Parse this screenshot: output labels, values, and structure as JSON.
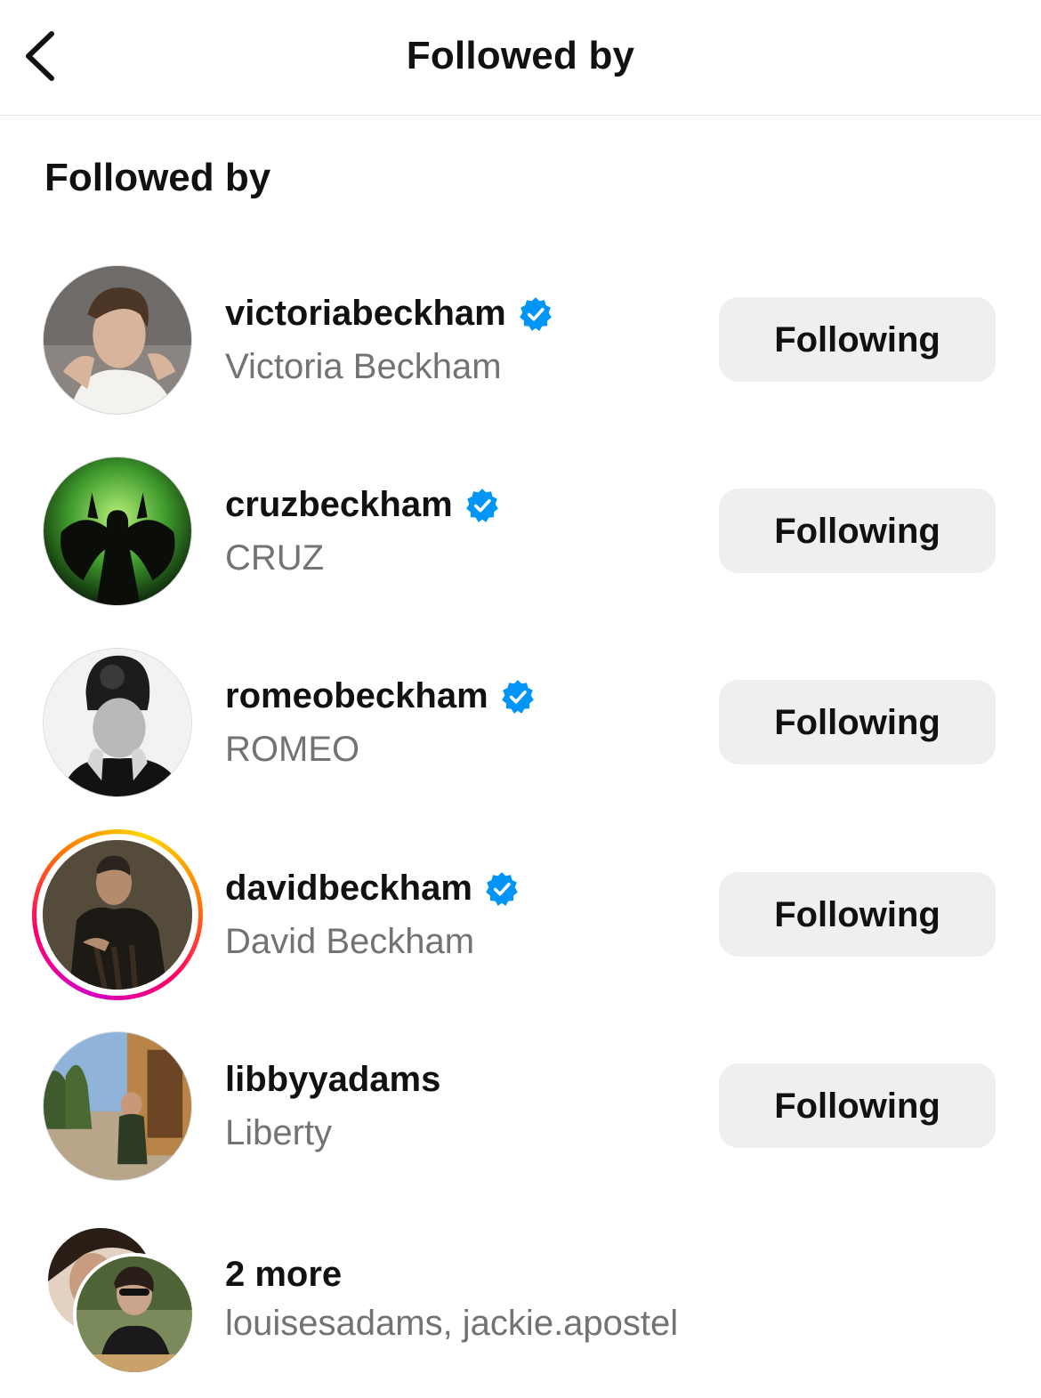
{
  "header": {
    "title": "Followed by",
    "back_icon": "chevron-left-icon"
  },
  "section": {
    "title": "Followed by"
  },
  "accounts": [
    {
      "username": "victoriabeckham",
      "full_name": "Victoria Beckham",
      "verified": true,
      "button": "Following"
    },
    {
      "username": "cruzbeckham",
      "full_name": "CRUZ",
      "verified": true,
      "button": "Following"
    },
    {
      "username": "romeobeckham",
      "full_name": "ROMEO",
      "verified": true,
      "button": "Following"
    },
    {
      "username": "davidbeckham",
      "full_name": "David Beckham",
      "verified": true,
      "has_story": true,
      "button": "Following"
    },
    {
      "username": "libbyyadams",
      "full_name": "Liberty",
      "verified": false,
      "button": "Following"
    }
  ],
  "more": {
    "title": "2 more",
    "names": "louisesadams, jackie.apostel"
  },
  "colors": {
    "verified_blue": "#0095f6",
    "button_bg": "#efefef",
    "secondary_text": "#737373"
  }
}
